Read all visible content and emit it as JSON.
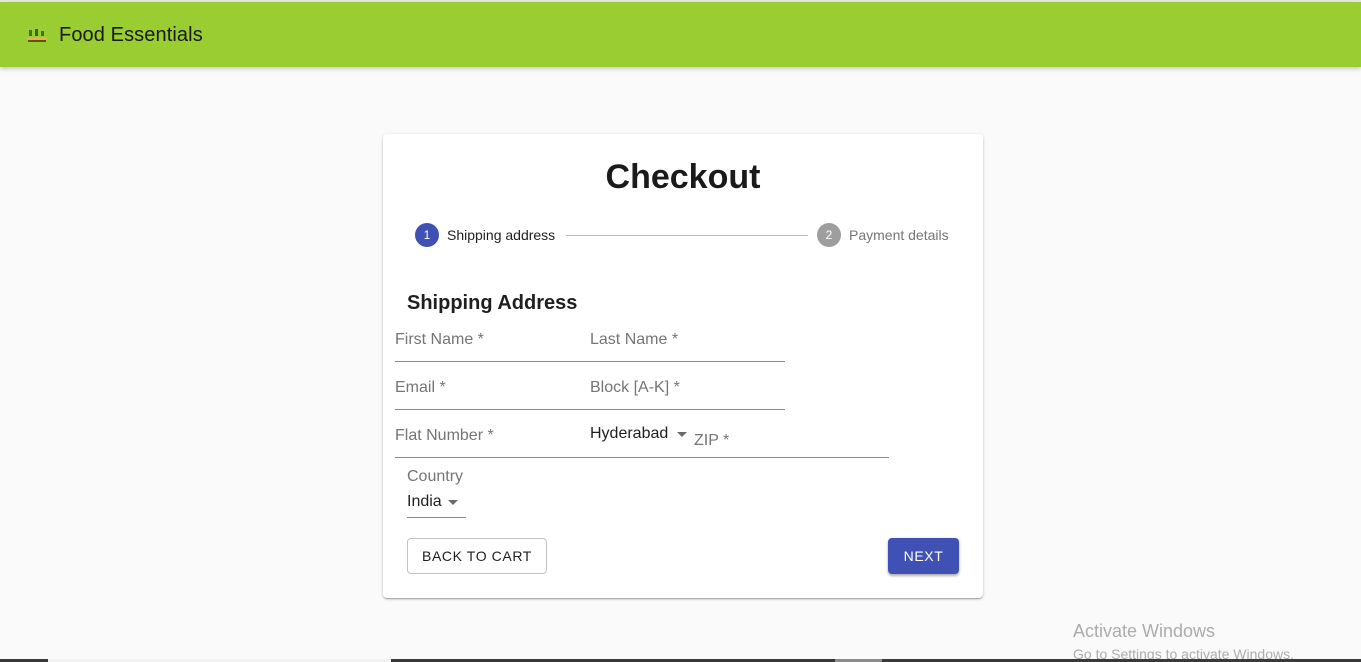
{
  "app": {
    "title": "Food Essentials",
    "logo_icon": "food-essentials-logo-icon",
    "brand_color": "#9acd32"
  },
  "checkout": {
    "title": "Checkout",
    "steps": [
      {
        "number": "1",
        "label": "Shipping address",
        "active": true
      },
      {
        "number": "2",
        "label": "Payment details",
        "active": false
      }
    ],
    "accent_color": "#3f51b5"
  },
  "shipping": {
    "section_title": "Shipping Address",
    "fields": {
      "first_name": {
        "label": "First Name *",
        "value": ""
      },
      "last_name": {
        "label": "Last Name *",
        "value": ""
      },
      "email": {
        "label": "Email *",
        "value": ""
      },
      "block": {
        "label": "Block [A-K] *",
        "value": ""
      },
      "flat_number": {
        "label": "Flat Number *",
        "value": ""
      },
      "city": {
        "value": "Hyderabad"
      },
      "zip": {
        "label": "ZIP *",
        "value": ""
      }
    },
    "country": {
      "label": "Country",
      "value": "India"
    }
  },
  "actions": {
    "back_label": "BACK TO CART",
    "next_label": "NEXT"
  },
  "watermark": {
    "line1": "Activate Windows",
    "line2": "Go to Settings to activate Windows."
  }
}
